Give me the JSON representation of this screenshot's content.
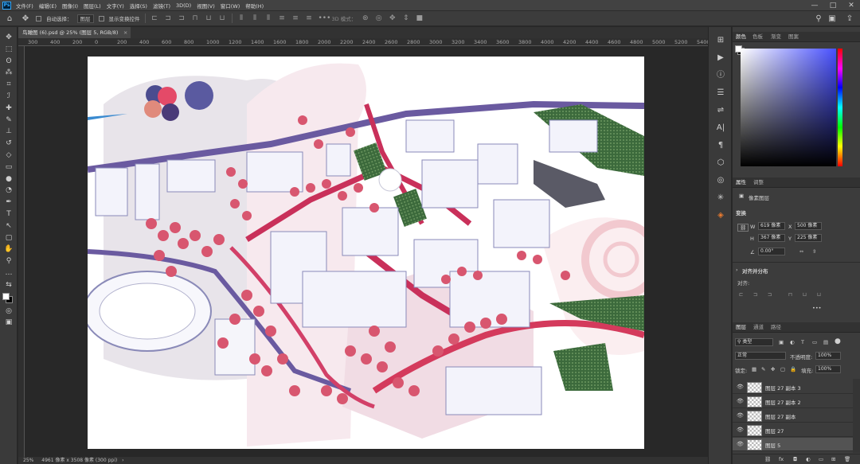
{
  "app": {
    "logo": "Ps"
  },
  "menu": [
    "文件(F)",
    "编辑(E)",
    "图像(I)",
    "图层(L)",
    "文字(Y)",
    "选择(S)",
    "滤镜(T)",
    "3D(D)",
    "视图(V)",
    "窗口(W)",
    "帮助(H)"
  ],
  "window_controls": [
    "—",
    "□",
    "✕"
  ],
  "options": {
    "auto_select_label": "自动选择：",
    "auto_select_target": "图层",
    "show_transform_label": "显示变换控件",
    "mode_3d": "3D 模式："
  },
  "tab": {
    "title": "鸟瞰图 (6).psd @ 25% (图层 5, RGB/8)",
    "close": "×"
  },
  "ruler_ticks": [
    "300",
    "400",
    "200",
    "0",
    "200",
    "400",
    "600",
    "800",
    "1000",
    "1200",
    "1400",
    "1600",
    "1800",
    "2000",
    "2200",
    "2400",
    "2600",
    "2800",
    "3000",
    "3200",
    "3400",
    "3600",
    "3800",
    "4000",
    "4200",
    "4400",
    "4600",
    "4800",
    "5000",
    "5200",
    "5400"
  ],
  "status": {
    "zoom": "25%",
    "doc_info": "4961 像素 x 3508 像素 (300 ppi)",
    "arrow": "›"
  },
  "color_panel": {
    "tabs": [
      "颜色",
      "色板",
      "渐变",
      "图案"
    ],
    "hue_color": "#4850ff"
  },
  "properties": {
    "tabs": [
      "属性",
      "调整"
    ],
    "kind": "像素图层",
    "transform_title": "变换",
    "w_label": "W",
    "w_value": "619 像素",
    "x_label": "X",
    "x_value": "500 像素",
    "h_label": "H",
    "h_value": "367 像素",
    "y_label": "Y",
    "y_value": "225 像素",
    "angle": "0.00°",
    "align_title": "对齐并分布",
    "align_label": "对齐:",
    "more": "•••"
  },
  "layers_panel": {
    "tabs": [
      "图层",
      "通道",
      "路径"
    ],
    "filter_kind": "类型",
    "blend_mode": "正常",
    "opacity_label": "不透明度:",
    "opacity_value": "100%",
    "lock_label": "锁定:",
    "fill_label": "填充:",
    "fill_value": "100%",
    "layers": [
      "图层 27 副本 3",
      "图层 27 副本 2",
      "图层 27 副本",
      "图层 27",
      "图层 5"
    ],
    "selected_index": 4,
    "footer_icons": [
      "link-icon",
      "fx-icon",
      "mask-icon",
      "adjustment-icon",
      "group-icon",
      "new-layer-icon",
      "trash-icon"
    ],
    "footer_glyphs": [
      "⛓",
      "fx",
      "◘",
      "◐",
      "▭",
      "⊞",
      "🗑"
    ]
  },
  "tools": [
    "move-icon",
    "marquee-icon",
    "lasso-icon",
    "quick-select-icon",
    "crop-icon",
    "eyedropper-icon",
    "heal-icon",
    "brush-icon",
    "stamp-icon",
    "history-brush-icon",
    "eraser-icon",
    "gradient-icon",
    "blur-icon",
    "dodge-icon",
    "pen-icon",
    "type-icon",
    "path-select-icon",
    "rectangle-icon",
    "hand-icon",
    "zoom-icon",
    "more-tools-icon",
    "swap-colors-icon",
    "foreground-color-icon",
    "quickmask-icon",
    "screen-mode-icon",
    "frame-icon"
  ],
  "tool_glyphs": [
    "✥",
    "⬚",
    "ʘ",
    "⁂",
    "⌗",
    "ℐ",
    "✚",
    "✎",
    "⊥",
    "↺",
    "◇",
    "▭",
    "●",
    "◔",
    "✒",
    "T",
    "↖",
    "▢",
    "✋",
    "⚲",
    "…",
    "⇆",
    "■",
    "◎",
    "▣",
    "▭"
  ],
  "dock_icons": [
    "arrange-icon",
    "play-icon",
    "info-icon",
    "history-icon",
    "adjust-icon",
    "character-icon",
    "paragraph-icon",
    "3d-icon",
    "clone-source-icon",
    "brush-settings-icon",
    "swatch-icon"
  ],
  "dock_glyphs": [
    "⊞",
    "▶",
    "ⓘ",
    "☰",
    "⇌",
    "A|",
    "¶",
    "⬡",
    "◎",
    "✳",
    "◈"
  ]
}
